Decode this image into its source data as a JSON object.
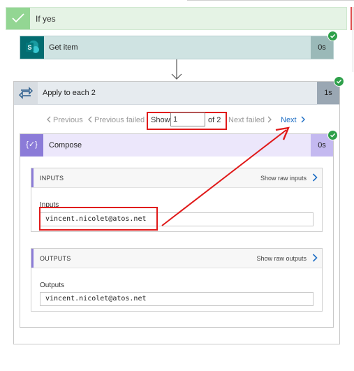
{
  "if_yes": {
    "label": "If yes"
  },
  "get_item": {
    "label": "Get item",
    "duration": "0s"
  },
  "apply_to_each": {
    "label": "Apply to each 2",
    "duration": "1s"
  },
  "pager": {
    "previous": "Previous",
    "previous_failed": "Previous failed",
    "show": "Show",
    "current_value": "1",
    "of_total": "of 2",
    "next_failed": "Next failed",
    "next": "Next"
  },
  "compose": {
    "label": "Compose",
    "duration": "0s",
    "icon_text": "{✓}",
    "inputs": {
      "header": "INPUTS",
      "raw_link": "Show raw inputs",
      "field_label": "Inputs",
      "field_value": "vincent.nicolet@atos.net"
    },
    "outputs": {
      "header": "OUTPUTS",
      "raw_link": "Show raw outputs",
      "field_label": "Outputs",
      "field_value": "vincent.nicolet@atos.net"
    }
  },
  "colors": {
    "success_green": "#2ea04a",
    "annotation_red": "#e01a1a",
    "link_blue": "#1f6fc5",
    "compose_purple": "#8b7bd8",
    "sharepoint_teal": "#036c70"
  }
}
